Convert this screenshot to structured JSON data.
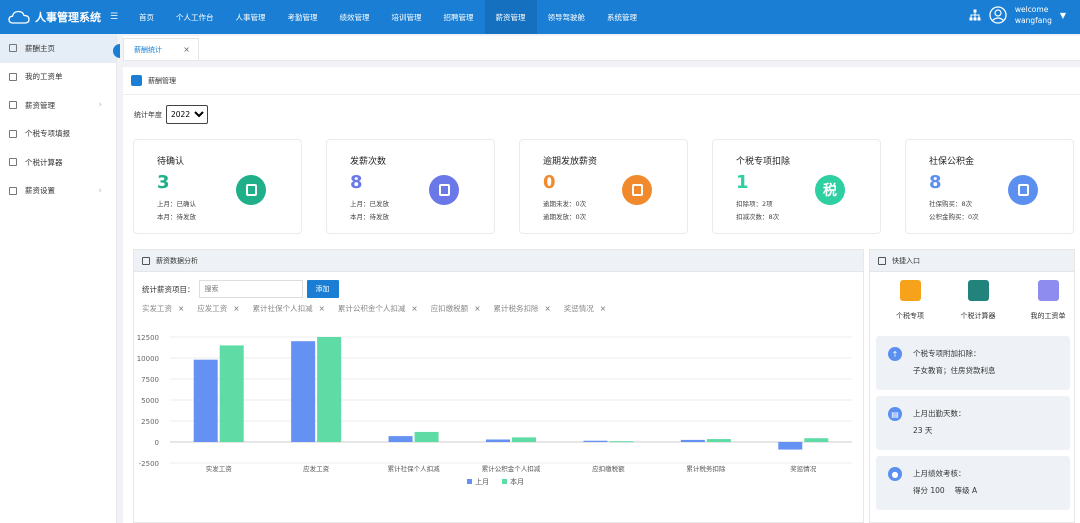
{
  "app": {
    "name": "人事管理系统"
  },
  "nav": [
    "首页",
    "个人工作台",
    "人事管理",
    "考勤管理",
    "绩效管理",
    "培训管理",
    "招聘管理",
    "薪资管理",
    "领导驾驶舱",
    "系统管理"
  ],
  "user": {
    "line1": "welcome",
    "line2": "wangfang"
  },
  "sidebar": {
    "items": [
      {
        "label": "薪酬主页"
      },
      {
        "label": "我的工资单"
      },
      {
        "label": "薪资管理"
      },
      {
        "label": "个税专项填报"
      },
      {
        "label": "个税计算器"
      },
      {
        "label": "薪资设置"
      }
    ]
  },
  "tab": {
    "label": "薪酬统计",
    "close": "×"
  },
  "breadcrumb": "薪酬管理",
  "year_filter": {
    "label": "统计年度",
    "value": "2022"
  },
  "cards": [
    {
      "title": "待确认",
      "value": "3",
      "line1": "上月：已确认",
      "line2": "本月：待发放",
      "color": "#1fb08a",
      "icon": "doc-icon"
    },
    {
      "title": "发薪次数",
      "value": "8",
      "line1": "上月：已发放",
      "line2": "本月：待发放",
      "color": "#6b78e8",
      "icon": "wallet-icon"
    },
    {
      "title": "逾期发放薪资",
      "value": "0",
      "line1": "逾期未发：0次",
      "line2": "逾期发放：0次",
      "color": "#f08a2c",
      "icon": "medal-icon"
    },
    {
      "title": "个税专项扣除",
      "value": "1",
      "line1": "扣除项：2项",
      "line2": "扣减次数：8次",
      "color": "#2ecfa0",
      "icon": "tax-icon",
      "badge": "税"
    },
    {
      "title": "社保公积金",
      "value": "8",
      "line1": "社保购买：8次",
      "line2": "公积金购买：0次",
      "color": "#5b8ff0",
      "icon": "hand-icon"
    }
  ],
  "analysis": {
    "title": "薪资数据分析",
    "filter_label": "统计薪资项目：",
    "search_placeholder": "搜索",
    "add_label": "添加",
    "chips": [
      "实发工资",
      "应发工资",
      "累计社保个人扣减",
      "累计公积金个人扣减",
      "应扣缴税额",
      "累计税务扣除",
      "奖惩情况"
    ]
  },
  "chart_data": {
    "type": "bar",
    "categories": [
      "实发工资",
      "应发工资",
      "累计社保个人扣减",
      "累计公积金个人扣减",
      "应扣缴税额",
      "累计税务扣除",
      "奖惩情况"
    ],
    "series": [
      {
        "name": "上月",
        "values": [
          9800,
          12000,
          700,
          300,
          150,
          250,
          -900
        ],
        "color": "#6591f3"
      },
      {
        "name": "本月",
        "values": [
          11500,
          12500,
          1200,
          550,
          100,
          350,
          450
        ],
        "color": "#5fdba6"
      }
    ],
    "yticks": [
      12500,
      10000,
      7500,
      5000,
      2500,
      0,
      -2500
    ],
    "ylim": [
      -2500,
      12500
    ],
    "legend": "bottom"
  },
  "quick": {
    "title": "快捷入口",
    "items": [
      {
        "label": "个税专项",
        "color": "#f7a21b"
      },
      {
        "label": "个税计算器",
        "color": "#22827c"
      },
      {
        "label": "我的工资单",
        "color": "#8f8cf0"
      }
    ],
    "info": [
      {
        "title": "个税专项附加扣除：",
        "detail": "子女教育；住房贷款利息",
        "icon": "arrow-up-icon",
        "glyph": "↑"
      },
      {
        "title": "上月出勤天数：",
        "detail": "23 天",
        "icon": "calendar-icon",
        "glyph": "▤"
      },
      {
        "title": "上月绩效考核：",
        "detail": "得分 100　 等级  A",
        "icon": "person-icon",
        "glyph": "●"
      }
    ]
  }
}
